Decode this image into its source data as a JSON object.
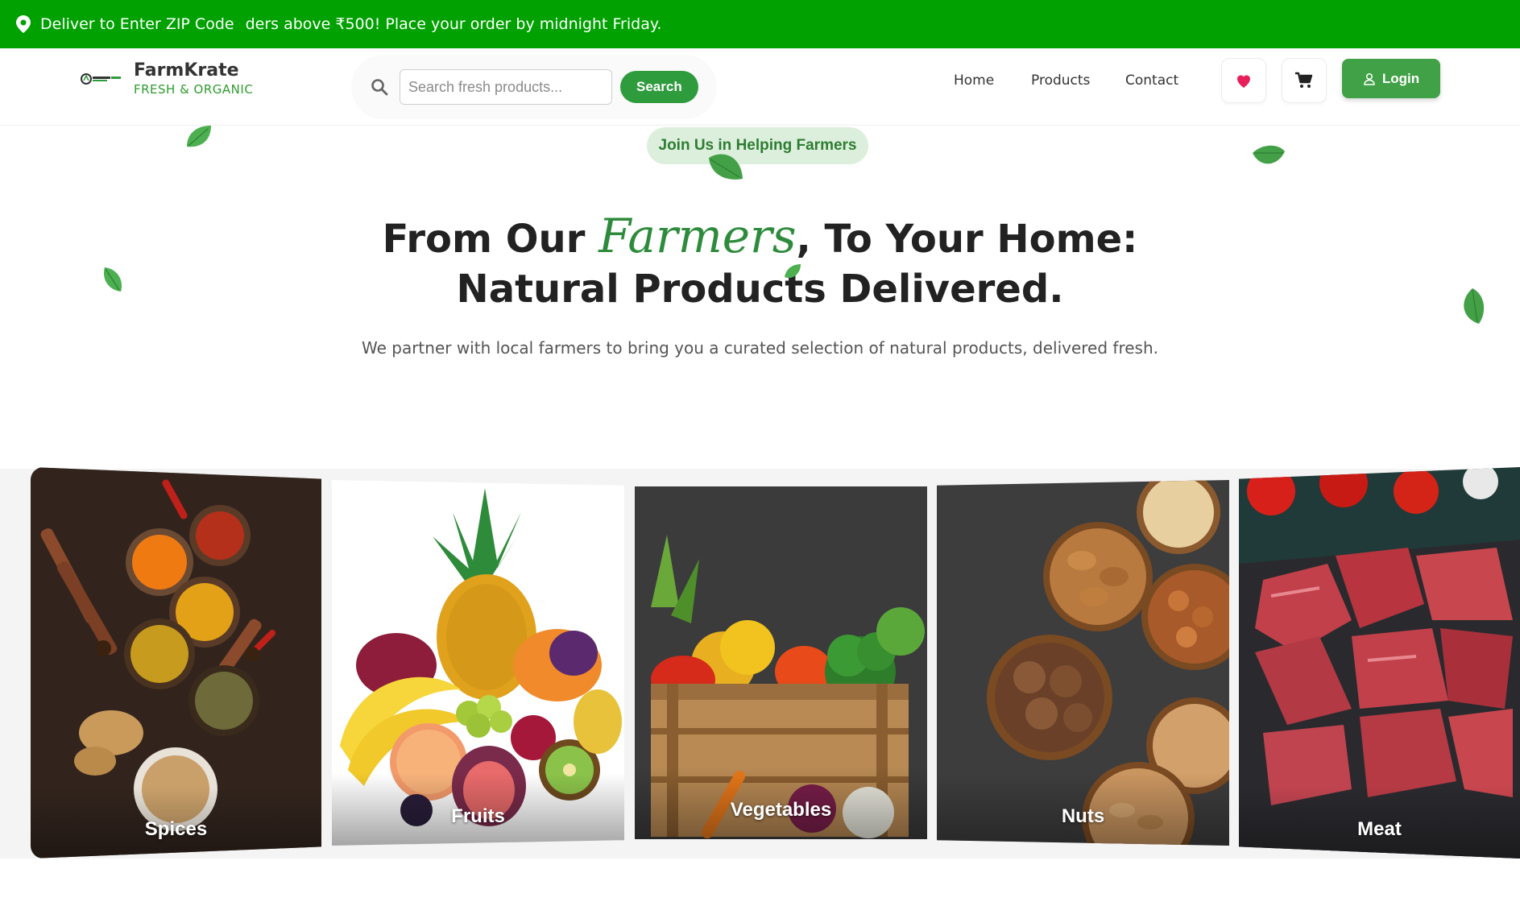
{
  "topbar": {
    "zip_text": "Deliver to Enter ZIP Code",
    "announcement": "ders above ₹500! Place your order by midnight Friday.",
    "bg_color": "#00a100"
  },
  "header": {
    "brand_name": "FarmKrate",
    "brand_tagline": "FRESH & ORGANIC",
    "search_placeholder": "Search fresh products...",
    "search_button": "Search",
    "nav": [
      "Home",
      "Products",
      "Contact"
    ],
    "login_label": "Login",
    "icons": [
      "location-pin-icon",
      "search-icon",
      "heart-icon",
      "cart-icon",
      "user-icon"
    ]
  },
  "hero": {
    "pill": "Join Us in Helping Farmers",
    "headline_part1": "From Our ",
    "headline_script": "Farmers",
    "headline_part2": ", To Your Home:",
    "headline_line2": "Natural Products Delivered.",
    "subtitle": "We partner with local farmers to bring you a curated selection of natural products, delivered fresh."
  },
  "categories": [
    {
      "label": "Spices"
    },
    {
      "label": "Fruits"
    },
    {
      "label": "Vegetables"
    },
    {
      "label": "Nuts"
    },
    {
      "label": "Meat"
    }
  ],
  "colors": {
    "accent": "#2e9b3c",
    "heart": "#e8205a"
  }
}
